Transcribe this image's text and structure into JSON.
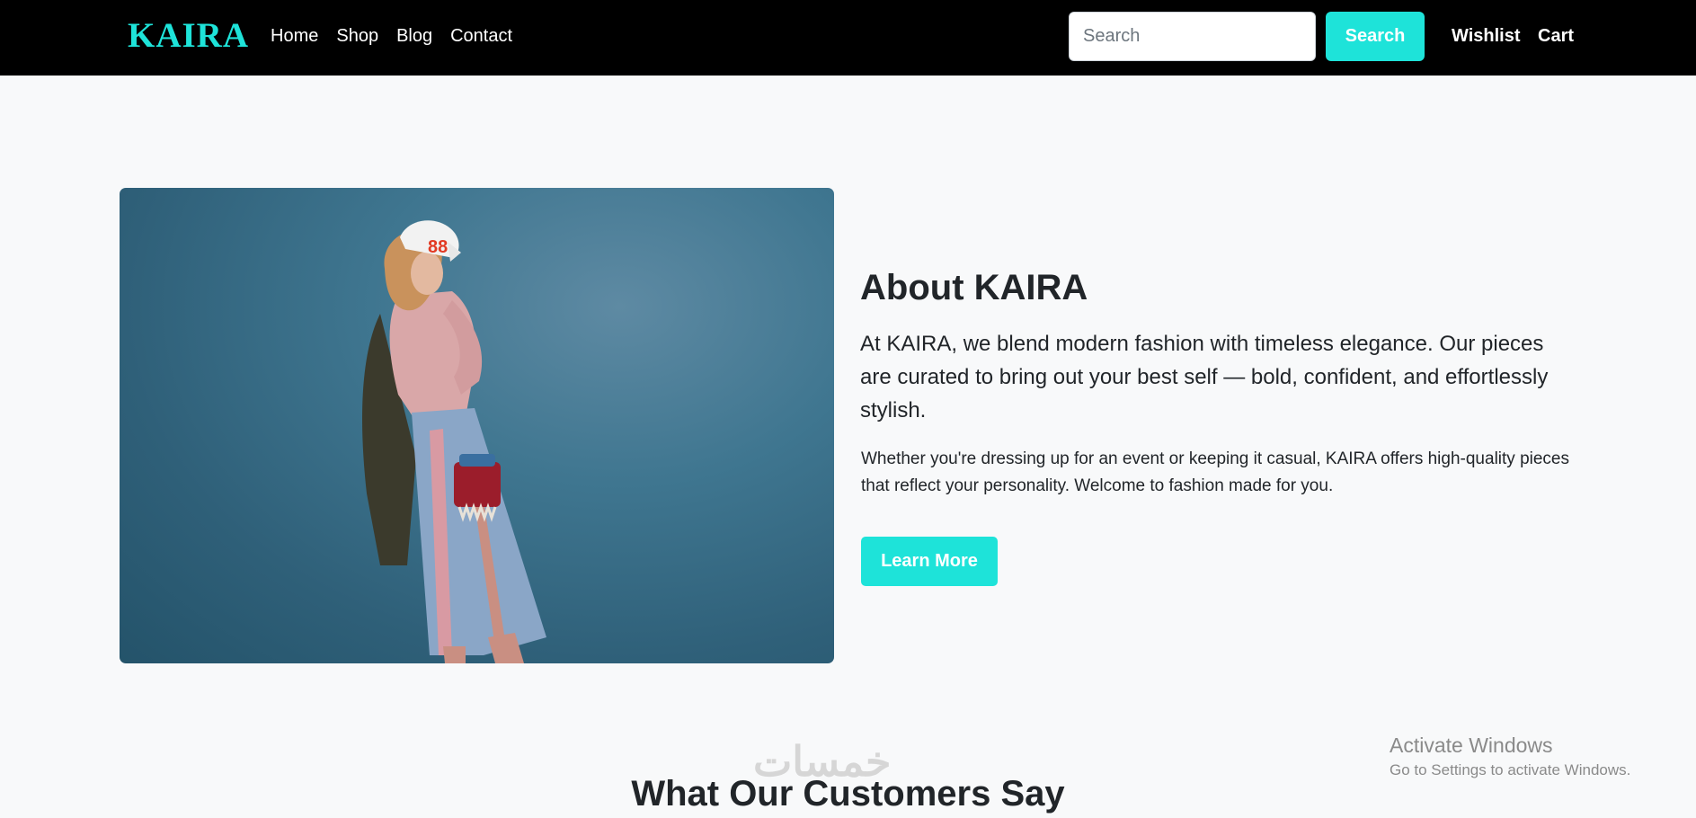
{
  "navbar": {
    "brand": "KAIRA",
    "links": [
      "Home",
      "Shop",
      "Blog",
      "Contact"
    ],
    "search": {
      "placeholder": "Search",
      "value": "",
      "button_label": "Search"
    },
    "wishlist_label": "Wishlist",
    "cart_label": "Cart"
  },
  "about": {
    "image_description": "model-photo",
    "title": "About KAIRA",
    "lead": "At KAIRA, we blend modern fashion with timeless elegance. Our pieces are curated to bring out your best self — bold, confident, and effortlessly stylish.",
    "body": "Whether you're dressing up for an event or keeping it casual, KAIRA offers high-quality pieces that reflect your personality. Welcome to fashion made for you.",
    "button_label": "Learn More"
  },
  "testimonials": {
    "title": "What Our Customers Say"
  },
  "watermark": {
    "logo_text": "خمسات"
  },
  "os_overlay": {
    "title": "Activate Windows",
    "subtitle": "Go to Settings to activate Windows."
  },
  "colors": {
    "accent": "#1ee3d9",
    "navbar_bg": "#000000",
    "page_bg": "#f8f9fa",
    "text": "#212529"
  }
}
